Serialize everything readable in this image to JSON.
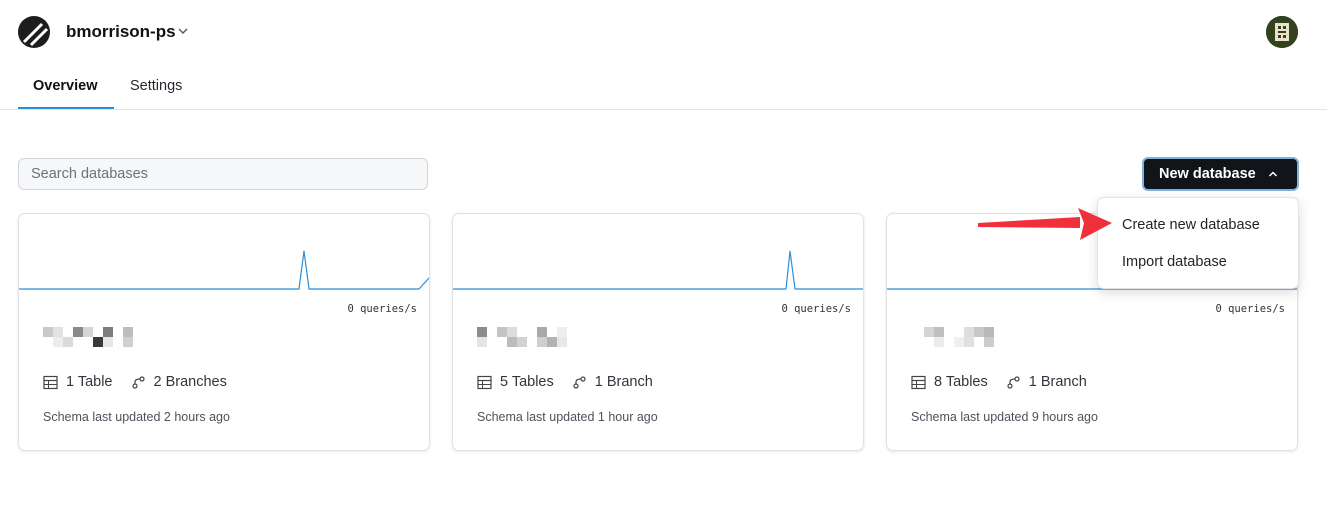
{
  "header": {
    "org_name": "bmorrison-ps",
    "logo_icon": "planetscale-logo-icon",
    "avatar_icon": "user-avatar-icon"
  },
  "tabs": [
    {
      "label": "Overview",
      "active": true
    },
    {
      "label": "Settings",
      "active": false
    }
  ],
  "search": {
    "placeholder": "Search databases",
    "value": ""
  },
  "new_database_button": {
    "label": "New database",
    "expanded": true
  },
  "dropdown": {
    "items": [
      {
        "label": "Create new database"
      },
      {
        "label": "Import database"
      }
    ]
  },
  "databases": [
    {
      "qps": "0 queries/s",
      "tables": "1 Table",
      "branches": "2 Branches",
      "updated": "Schema last updated 2 hours ago"
    },
    {
      "qps": "0 queries/s",
      "tables": "5 Tables",
      "branches": "1 Branch",
      "updated": "Schema last updated 1 hour ago"
    },
    {
      "qps": "0 queries/s",
      "tables": "8 Tables",
      "branches": "1 Branch",
      "updated": "Schema last updated 9 hours ago"
    }
  ],
  "colors": {
    "accent_blue": "#2b8fd8",
    "button_bg": "#111418",
    "annotation_red": "#f0313c"
  }
}
